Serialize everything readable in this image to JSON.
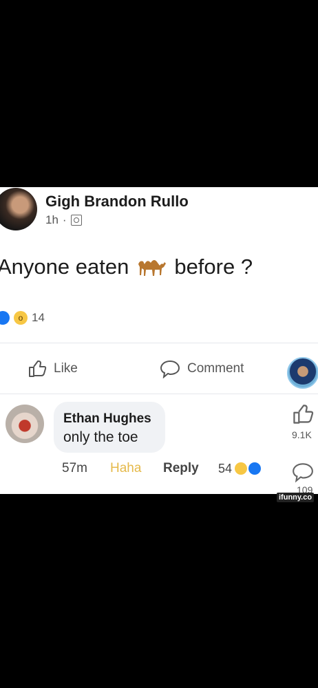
{
  "post": {
    "author": "Gigh Brandon Rullo",
    "time": "1h",
    "separator": "·",
    "text_before": "Anyone eaten",
    "text_after": "before ?",
    "reaction_count": "14"
  },
  "actions": {
    "like_label": "Like",
    "comment_label": "Comment"
  },
  "comment": {
    "author": "Ethan Hughes",
    "text": "only the toe",
    "time": "57m",
    "haha_label": "Haha",
    "reply_label": "Reply",
    "reaction_count": "54"
  },
  "sidebar": {
    "like_count": "9.1K",
    "comment_count": "109"
  },
  "watermark": "ifunny.co",
  "icons": [
    "audience-icon",
    "camel-icon",
    "like-reaction-icon",
    "wow-reaction-icon",
    "thumbs-up-icon",
    "comment-icon",
    "haha-reaction-icon"
  ],
  "colors": {
    "background": "#000000",
    "panel": "#ffffff",
    "accent": "#1877f2",
    "haha": "#e5b94a"
  }
}
